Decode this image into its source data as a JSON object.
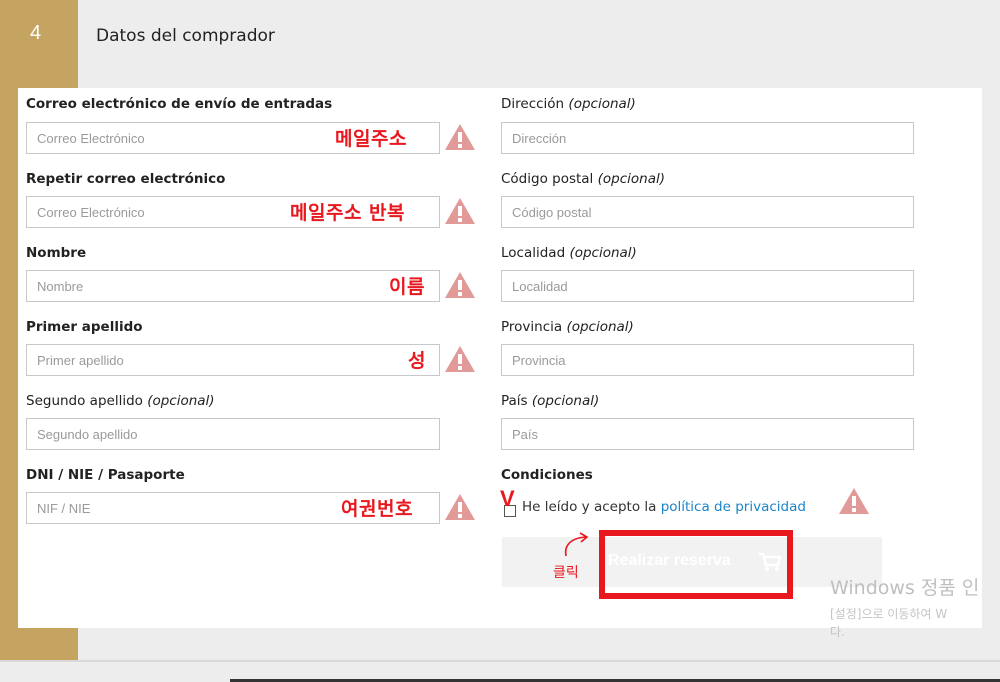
{
  "section": {
    "step": "4",
    "title": "Datos del comprador"
  },
  "left_fields": [
    {
      "label": "Correo electrónico de envío de entradas",
      "optional": "",
      "placeholder": "Correo Electrónico",
      "note": "메일주소"
    },
    {
      "label": "Repetir correo electrónico",
      "optional": "",
      "placeholder": "Correo Electrónico",
      "note": "메일주소 반복"
    },
    {
      "label": "Nombre",
      "optional": "",
      "placeholder": "Nombre",
      "note": "이름"
    },
    {
      "label": "Primer apellido",
      "optional": "",
      "placeholder": "Primer apellido",
      "note": "성"
    },
    {
      "label": "Segundo apellido ",
      "optional": "(opcional)",
      "placeholder": "Segundo apellido",
      "note": ""
    },
    {
      "label": "DNI / NIE / Pasaporte",
      "optional": "",
      "placeholder": "NIF / NIE",
      "note": "여권번호"
    }
  ],
  "right_fields": [
    {
      "label": "Dirección ",
      "optional": "(opcional)",
      "placeholder": "Dirección"
    },
    {
      "label": "Código postal ",
      "optional": "(opcional)",
      "placeholder": "Código postal"
    },
    {
      "label": "Localidad ",
      "optional": "(opcional)",
      "placeholder": "Localidad"
    },
    {
      "label": "Provincia ",
      "optional": "(opcional)",
      "placeholder": "Provincia"
    },
    {
      "label": "País ",
      "optional": "(opcional)",
      "placeholder": "País"
    }
  ],
  "conditions": {
    "label": "Condiciones",
    "accept_text": "He leído y acepto la ",
    "link_text": "política de privacidad",
    "check_mark": "V"
  },
  "submit": {
    "label": "Realizar reserva"
  },
  "annotation": {
    "click_label": "클릭"
  },
  "watermark": {
    "line1": "Windows 정품 인",
    "line2": "[설정]으로 이동하여 W",
    "line3": "다."
  },
  "colors": {
    "accent_gold": "#c5a462",
    "annotation_red": "#e8181e",
    "warning_salmon": "#e19a98",
    "link_blue": "#1a85c8"
  }
}
